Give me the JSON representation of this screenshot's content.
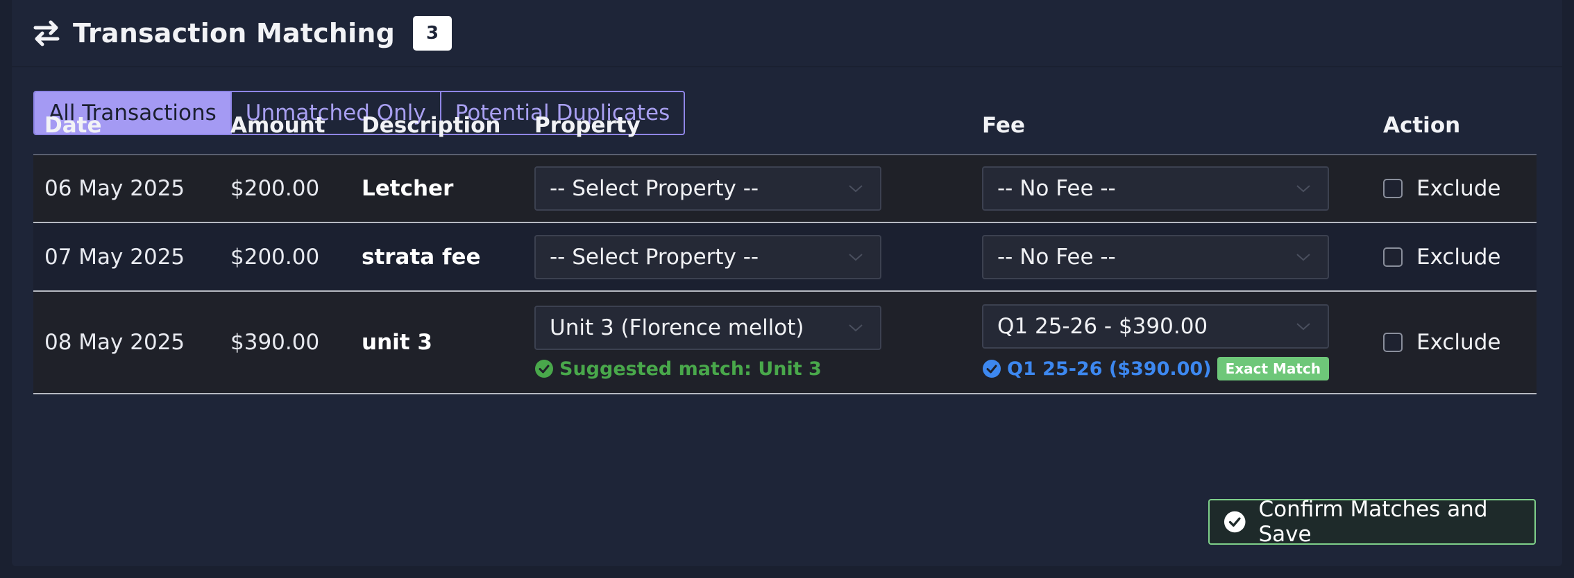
{
  "header": {
    "title": "Transaction Matching",
    "count": "3"
  },
  "tabs": [
    {
      "label": "All Transactions",
      "active": true
    },
    {
      "label": "Unmatched Only",
      "active": false
    },
    {
      "label": "Potential Duplicates",
      "active": false
    }
  ],
  "table": {
    "columns": [
      "Date",
      "Amount",
      "Description",
      "Property",
      "Fee",
      "Action"
    ],
    "rows": [
      {
        "date": "06 May 2025",
        "amount": "$200.00",
        "description": "Letcher",
        "property": "-- Select Property --",
        "fee": "-- No Fee --",
        "action": "Exclude"
      },
      {
        "date": "07 May 2025",
        "amount": "$200.00",
        "description": "strata fee",
        "property": "-- Select Property --",
        "fee": "-- No Fee --",
        "action": "Exclude"
      },
      {
        "date": "08 May 2025",
        "amount": "$390.00",
        "description": "unit 3",
        "property": "Unit 3 (Florence mellot)",
        "fee": "Q1 25-26 - $390.00",
        "action": "Exclude",
        "property_suggestion": "Suggested match: Unit 3",
        "fee_suggestion": "Q1 25-26 ($390.00)",
        "fee_badge": "Exact Match"
      }
    ]
  },
  "confirm_label": "Confirm Matches and Save",
  "colors": {
    "accent": "#a49af3",
    "success": "#49a84b",
    "info": "#3d88f0",
    "badge": "#6ec779"
  }
}
